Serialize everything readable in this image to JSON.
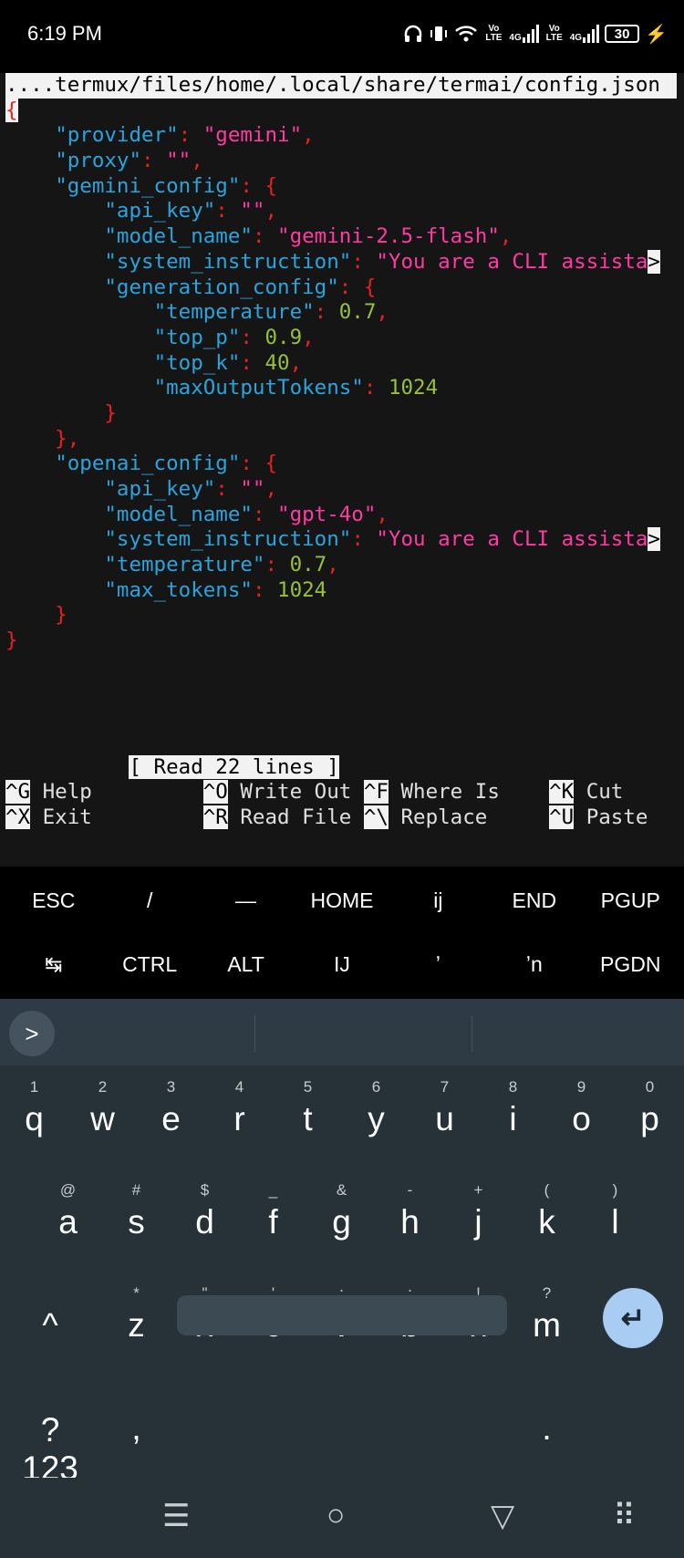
{
  "status_bar": {
    "time": "6:19 PM",
    "network_labels": [
      "Vo LTE",
      "4G",
      "Vo LTE",
      "4G"
    ],
    "battery": "30"
  },
  "editor": {
    "header_path": "....termux/files/home/.local/share/termai/config.json",
    "status_message": "[ Read 22 lines ]"
  },
  "file_lines": {
    "l1_brace": "{",
    "l2_key": "\"provider\"",
    "l2_val": "\"gemini\"",
    "l3_key": "\"proxy\"",
    "l3_val": "\"\"",
    "l4_key": "\"gemini_config\"",
    "l5_key": "\"api_key\"",
    "l5_val": "\"\"",
    "l6_key": "\"model_name\"",
    "l6_val": "\"gemini-2.5-flash\"",
    "l7_key": "\"system_instruction\"",
    "l7_val": "\"You are a CLI assista",
    "l8_key": "\"generation_config\"",
    "l9_key": "\"temperature\"",
    "l9_val": "0.7",
    "l10_key": "\"top_p\"",
    "l10_val": "0.9",
    "l11_key": "\"top_k\"",
    "l11_val": "40",
    "l12_key": "\"maxOutputTokens\"",
    "l12_val": "1024",
    "l15_key": "\"openai_config\"",
    "l16_key": "\"api_key\"",
    "l16_val": "\"\"",
    "l17_key": "\"model_name\"",
    "l17_val": "\"gpt-4o\"",
    "l18_key": "\"system_instruction\"",
    "l18_val": "\"You are a CLI assista",
    "l19_key": "\"temperature\"",
    "l19_val": "0.7",
    "l20_key": "\"max_tokens\"",
    "l20_val": "1024"
  },
  "shortcuts": [
    {
      "key": "^G",
      "label": "Help"
    },
    {
      "key": "^O",
      "label": "Write Out"
    },
    {
      "key": "^F",
      "label": "Where Is"
    },
    {
      "key": "^K",
      "label": "Cut"
    },
    {
      "key": "^X",
      "label": "Exit"
    },
    {
      "key": "^R",
      "label": "Read File"
    },
    {
      "key": "^\\",
      "label": "Replace"
    },
    {
      "key": "^U",
      "label": "Paste"
    }
  ],
  "extra_keys": {
    "row1": [
      "ESC",
      "/",
      "—",
      "HOME",
      "ij",
      "END",
      "PGUP"
    ],
    "row2": [
      "↹",
      "CTRL",
      "ALT",
      "IJ",
      "ʼ",
      "ʼn",
      "PGDN"
    ]
  },
  "keyboard": {
    "suggestion_button": ">",
    "row1": [
      {
        "main": "q",
        "hint": "1"
      },
      {
        "main": "w",
        "hint": "2"
      },
      {
        "main": "e",
        "hint": "3"
      },
      {
        "main": "r",
        "hint": "4"
      },
      {
        "main": "t",
        "hint": "5"
      },
      {
        "main": "y",
        "hint": "6"
      },
      {
        "main": "u",
        "hint": "7"
      },
      {
        "main": "i",
        "hint": "8"
      },
      {
        "main": "o",
        "hint": "9"
      },
      {
        "main": "p",
        "hint": "0"
      }
    ],
    "row2": [
      {
        "main": "a",
        "hint": "@"
      },
      {
        "main": "s",
        "hint": "#"
      },
      {
        "main": "d",
        "hint": "$"
      },
      {
        "main": "f",
        "hint": "_"
      },
      {
        "main": "g",
        "hint": "&"
      },
      {
        "main": "h",
        "hint": "-"
      },
      {
        "main": "j",
        "hint": "+"
      },
      {
        "main": "k",
        "hint": "("
      },
      {
        "main": "l",
        "hint": ")"
      }
    ],
    "row3": [
      {
        "main": "z",
        "hint": "*"
      },
      {
        "main": "x",
        "hint": "\""
      },
      {
        "main": "c",
        "hint": "'"
      },
      {
        "main": "v",
        "hint": ":"
      },
      {
        "main": "b",
        "hint": ";"
      },
      {
        "main": "n",
        "hint": "!"
      },
      {
        "main": "m",
        "hint": "?"
      }
    ],
    "shift": "^",
    "backspace": "⌫",
    "symbols": "?123",
    "comma": ",",
    "period": ".",
    "enter": "↵"
  },
  "nav_bar": {
    "menu": "☰",
    "home": "○",
    "back": "▽",
    "keyboard_switch": "⠿"
  }
}
